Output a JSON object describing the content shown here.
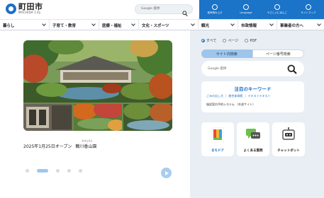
{
  "header": {
    "logo_jp": "町田市",
    "logo_en": "MACHIDA City",
    "search_label": "Google 提供"
  },
  "utility": [
    {
      "label": "音声読み上げ",
      "icon": "speaker-icon"
    },
    {
      "label": "Language",
      "icon": "globe-icon"
    },
    {
      "label": "やさしいにほんご",
      "icon": "person-icon"
    },
    {
      "label": "サイトマップ",
      "icon": "sitemap-icon"
    }
  ],
  "nav": [
    {
      "label": "暮らし"
    },
    {
      "label": "子育て・教育"
    },
    {
      "label": "医療・福祉"
    },
    {
      "label": "文化・スポーツ"
    },
    {
      "label": "観光"
    },
    {
      "label": "市政情報"
    },
    {
      "label": "事業者の方へ"
    }
  ],
  "hero": {
    "caption_prefix": "2025年1月25日オープン",
    "caption_place": "鶴川香山園",
    "caption_ruby": "かさんえん"
  },
  "carousel": {
    "slides": 5,
    "active_index": 1
  },
  "search_panel": {
    "radio_all": "すべて",
    "radio_page": "ページ",
    "radio_pdf": "PDF",
    "tab_site": "サイト内検索",
    "tab_page_number": "ページ番号検索",
    "google_label": "Google 提供"
  },
  "keywords": {
    "title": "注目のキーワード",
    "items": [
      "ごみの出し方",
      "総合体育館",
      "テキストテキスト"
    ],
    "row2": "施設案内予約システム （外部サイト）"
  },
  "cards": [
    {
      "label": "まちドア",
      "icon": "machidoor-logo-icon"
    },
    {
      "label": "よくある質問",
      "icon": "chat-icon"
    },
    {
      "label": "チャットボット",
      "icon": "chatbot-icon"
    }
  ],
  "colors": {
    "primary": "#1b74c8",
    "sidebar_bg": "#e8eef4",
    "tab_active": "#9ec5eb",
    "link": "#1b6fc6"
  }
}
